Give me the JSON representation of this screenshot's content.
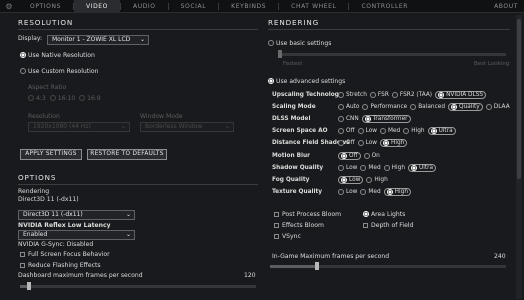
{
  "nav": {
    "tabs": [
      {
        "label": "OPTIONS"
      },
      {
        "label": "VIDEO"
      },
      {
        "label": "AUDIO"
      },
      {
        "label": "SOCIAL"
      },
      {
        "label": "KEYBINDS"
      },
      {
        "label": "CHAT WHEEL"
      },
      {
        "label": "CONTROLLER"
      }
    ],
    "about": "ABOUT"
  },
  "resolution": {
    "title": "RESOLUTION",
    "display_label": "Display:",
    "display_value": "Monitor 1 - ZOWIE XL LCD",
    "use_native": "Use Native Resolution",
    "use_custom": "Use Custom Resolution",
    "aspect_ratio_label": "Aspect Ratio",
    "aspect_options": [
      "4:3",
      "16:10",
      "16:9"
    ],
    "resolution_label": "Resolution",
    "resolution_value": "1920x1080 (44 Hz)",
    "window_mode_label": "Window Mode",
    "window_mode_value": "Borderless Window",
    "apply": "APPLY SETTINGS",
    "restore": "RESTORE TO DEFAULTS"
  },
  "options": {
    "title": "OPTIONS",
    "rendering_label": "Rendering",
    "rendering_current": "Direct3D 11 (-dx11)",
    "rendering_select": "Direct3D 11 (-dx11)",
    "reflex_label": "NVIDIA Reflex Low Latency",
    "reflex_value": "Enabled",
    "gsync": "NVIDIA G-Sync:  Disabled",
    "full_screen_focus": "Full Screen Focus Behavior",
    "reduce_flashing": "Reduce Flashing Effects",
    "dashboard_fps_label": "Dashboard maximum frames per second",
    "dashboard_fps_value": "120",
    "dashboard_fps_fraction": 0.04
  },
  "rendering": {
    "title": "RENDERING",
    "use_basic": "Use basic settings",
    "basic_left": "Fastest",
    "basic_right": "Best Looking",
    "use_advanced": "Use advanced settings",
    "rows": [
      {
        "name": "Upscaling Technology",
        "opts": [
          "Stretch",
          "FSR",
          "FSR2 (TAA)",
          "NVIDIA DLSS"
        ],
        "sel": 3
      },
      {
        "name": "Scaling Mode",
        "opts": [
          "Auto",
          "Performance",
          "Balanced",
          "Quality",
          "DLAA"
        ],
        "sel": 3
      },
      {
        "name": "DLSS Model",
        "opts": [
          "CNN",
          "Transformer"
        ],
        "sel": 1
      },
      {
        "name": "Screen Space AO",
        "opts": [
          "Off",
          "Low",
          "Med",
          "High",
          "Ultra"
        ],
        "sel": 4
      },
      {
        "name": "Distance Field Shadows",
        "opts": [
          "Off",
          "Low",
          "High"
        ],
        "sel": 2
      },
      {
        "name": "Motion Blur",
        "opts": [
          "Off",
          "On"
        ],
        "sel": 0
      },
      {
        "name": "Shadow Quality",
        "opts": [
          "Low",
          "Med",
          "High",
          "Ultra"
        ],
        "sel": 3
      },
      {
        "name": "Fog Quality",
        "opts": [
          "Low",
          "High"
        ],
        "sel": 0
      },
      {
        "name": "Texture Quality",
        "opts": [
          "Low",
          "Med",
          "High"
        ],
        "sel": 2
      }
    ],
    "checks_left": [
      "Post Process Bloom",
      "Effects Bloom",
      "VSync"
    ],
    "checks_right": [
      "Area Lights",
      "Depth of Field"
    ],
    "ingame_fps_label": "In-Game Maximum frames per second",
    "ingame_fps_value": "240",
    "ingame_fps_fraction": 0.2
  }
}
